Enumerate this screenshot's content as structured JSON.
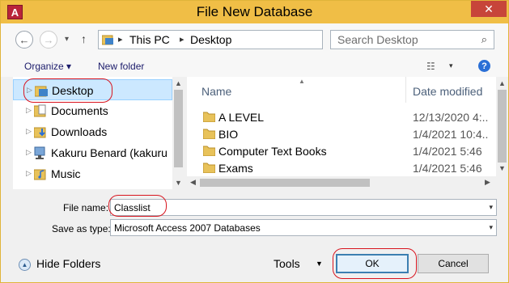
{
  "window": {
    "app_icon": "A",
    "title": "File New Database",
    "close_glyph": "✕"
  },
  "navigation": {
    "back_glyph": "←",
    "forward_glyph": "→",
    "recent_glyph": "▾",
    "up_glyph": "↑",
    "breadcrumbs": [
      "This PC",
      "Desktop"
    ],
    "refresh_glyph": "↻",
    "search_placeholder": "Search Desktop",
    "search_glyph": "⌕"
  },
  "toolbar": {
    "organize_label": "Organize ▾",
    "new_folder_label": "New folder",
    "view_glyph": "☷",
    "help_glyph": "?"
  },
  "nav_pane": {
    "items": [
      {
        "label": "Desktop",
        "icon": "desktop-folder-icon",
        "selected": true
      },
      {
        "label": "Documents",
        "icon": "documents-icon"
      },
      {
        "label": "Downloads",
        "icon": "downloads-icon"
      },
      {
        "label": "Kakuru Benard (kakuru",
        "icon": "network-user-icon"
      },
      {
        "label": "Music",
        "icon": "music-icon"
      }
    ]
  },
  "file_list": {
    "columns": {
      "name": "Name",
      "date": "Date modified"
    },
    "rows": [
      {
        "name": "A LEVEL",
        "date": "12/13/2020 4:.."
      },
      {
        "name": "BIO",
        "date": "1/4/2021 10:4.."
      },
      {
        "name": "Computer Text Books",
        "date": "1/4/2021 5:46"
      },
      {
        "name": "Exams",
        "date": "1/4/2021 5:46"
      }
    ]
  },
  "form": {
    "file_name_label": "File name:",
    "file_name_value": "Classlist",
    "save_type_label": "Save as type:",
    "save_type_value": "Microsoft Access 2007 Databases"
  },
  "footer": {
    "hide_folders_label": "Hide Folders",
    "tools_label": "Tools",
    "ok_label": "OK",
    "cancel_label": "Cancel"
  },
  "colors": {
    "title_bar": "#f0be46",
    "selection": "#cce8ff",
    "annotation": "#d8141e"
  }
}
